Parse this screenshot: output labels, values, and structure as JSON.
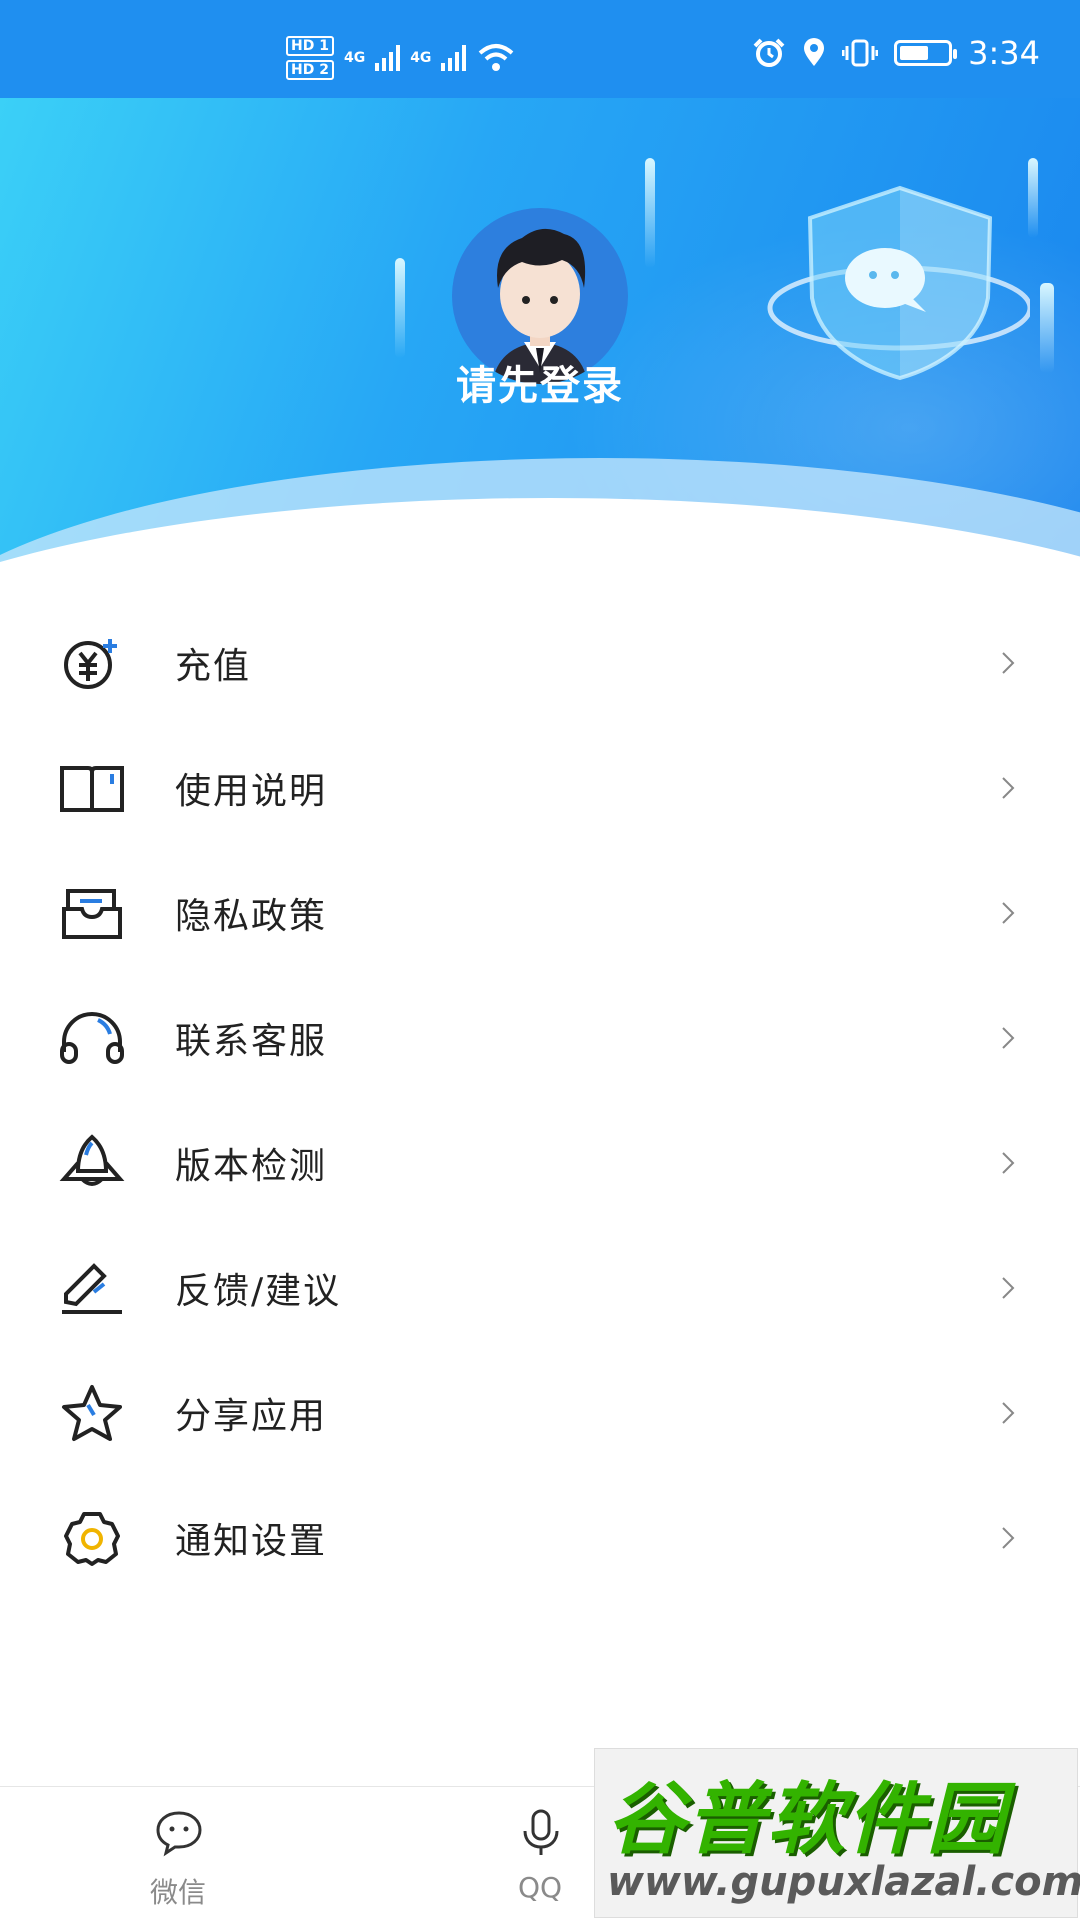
{
  "status_bar": {
    "hd1": "HD 1",
    "hd2": "HD 2",
    "net1": "4G",
    "net2": "4G",
    "time": "3:34",
    "battery_level": 0.6
  },
  "header": {
    "login_prompt": "请先登录"
  },
  "menu": {
    "items": [
      {
        "label": "充值",
        "icon": "yuan-add-icon"
      },
      {
        "label": "使用说明",
        "icon": "book-icon"
      },
      {
        "label": "隐私政策",
        "icon": "inbox-icon"
      },
      {
        "label": "联系客服",
        "icon": "headset-icon"
      },
      {
        "label": "版本检测",
        "icon": "rocket-icon"
      },
      {
        "label": "反馈/建议",
        "icon": "edit-icon"
      },
      {
        "label": "分享应用",
        "icon": "star-icon"
      },
      {
        "label": "通知设置",
        "icon": "gear-icon"
      }
    ],
    "chevron": "›"
  },
  "tab_bar": {
    "tabs": [
      {
        "label": "微信",
        "icon": "wechat-icon"
      },
      {
        "label": "QQ",
        "icon": "microphone-icon"
      }
    ]
  },
  "watermark": {
    "title": "谷普软件园",
    "url": "www.gupuxlazal.com"
  },
  "colors": {
    "accent": "#1f8ff0",
    "icon_accent": "#2a7de1"
  }
}
